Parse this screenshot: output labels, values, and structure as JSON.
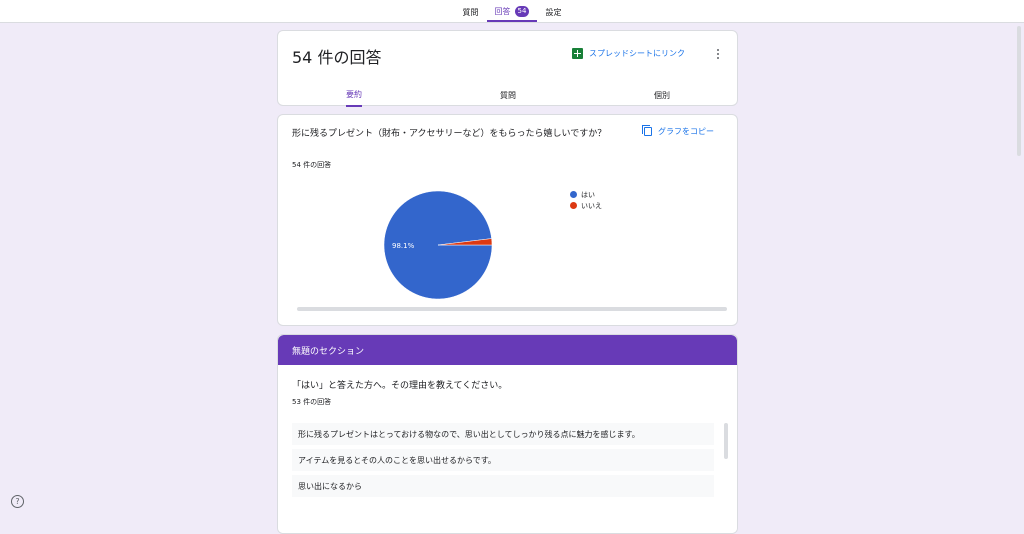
{
  "topnav": {
    "tabs": [
      {
        "label": "質問"
      },
      {
        "label": "回答",
        "badge": "54",
        "active": true
      },
      {
        "label": "設定"
      }
    ]
  },
  "summary": {
    "title": "54 件の回答",
    "link_label": "スプレッドシートにリンク",
    "tabs": [
      {
        "label": "要約",
        "active": true
      },
      {
        "label": "質問"
      },
      {
        "label": "個別"
      }
    ]
  },
  "question1": {
    "title": "形に残るプレゼント（財布・アクセサリーなど）をもらったら嬉しいですか？",
    "count": "54 件の回答",
    "copy_label": "グラフをコピー"
  },
  "chart_data": {
    "type": "pie",
    "categories": [
      "はい",
      "いいえ"
    ],
    "values": [
      98.1,
      1.9
    ],
    "colors": [
      "#3366cc",
      "#dc3912"
    ],
    "slice_labels": [
      "98.1%",
      ""
    ],
    "legend": "right"
  },
  "section": {
    "title": "無題のセクション",
    "question": "「はい」と答えた方へ。その理由を教えてください。",
    "count": "53 件の回答",
    "answers": [
      "形に残るプレゼントはとっておける物なので、思い出としてしっかり残る点に魅力を感じます。",
      "アイテムを見るとその人のことを思い出せるからです。",
      "思い出になるから"
    ]
  },
  "colors": {
    "accent": "#673ab7",
    "background": "#f0ebf8",
    "link": "#1a73e8"
  },
  "icons": {
    "sheet": "spreadsheet-icon",
    "copy": "copy-icon",
    "more": "more-vert-icon",
    "help": "help-icon"
  }
}
